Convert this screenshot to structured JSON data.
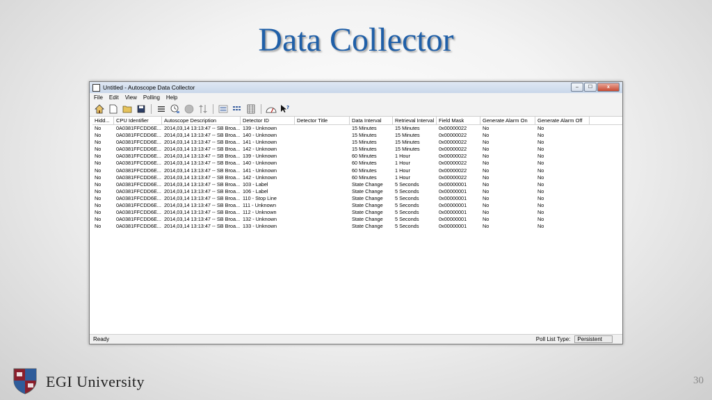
{
  "slide": {
    "title": "Data Collector",
    "page_number": "30",
    "university": "EGI University"
  },
  "window": {
    "title": "Untitled - Autoscope Data Collector",
    "controls": {
      "minimize": "–",
      "maximize": "☐",
      "close": "x"
    }
  },
  "menu": [
    "File",
    "Edit",
    "View",
    "Polling",
    "Help"
  ],
  "toolbar_icons": [
    "home-icon",
    "new-file-icon",
    "open-folder-icon",
    "save-icon",
    "list-icon",
    "clock-icon",
    "record-icon",
    "sort-icon",
    "detail-view-icon",
    "list-view-icon",
    "grid-view-icon",
    "gauge-icon",
    "help-cursor-icon"
  ],
  "table": {
    "columns": [
      "Hidd...",
      "CPU Identifier",
      "Autoscope Description",
      "Detector ID",
      "Detector Title",
      "Data Interval",
      "Retrieval Interval",
      "Field Mask",
      "Generate Alarm On",
      "Generate Alarm Off"
    ],
    "rows": [
      [
        "No",
        "0A0381FFCDD6E...",
        "2014,03,14  13:13:47 -- SB Broa...",
        "139 - Unknown",
        "",
        "15 Minutes",
        "15 Minutes",
        "0x00000022",
        "No",
        "No"
      ],
      [
        "No",
        "0A0381FFCDD6E...",
        "2014,03,14  13:13:47 -- SB Broa...",
        "140 - Unknown",
        "",
        "15 Minutes",
        "15 Minutes",
        "0x00000022",
        "No",
        "No"
      ],
      [
        "No",
        "0A0381FFCDD6E...",
        "2014,03,14  13:13:47 -- SB Broa...",
        "141 - Unknown",
        "",
        "15 Minutes",
        "15 Minutes",
        "0x00000022",
        "No",
        "No"
      ],
      [
        "No",
        "0A0381FFCDD6E...",
        "2014,03,14  13:13:47 -- SB Broa...",
        "142 - Unknown",
        "",
        "15 Minutes",
        "15 Minutes",
        "0x00000022",
        "No",
        "No"
      ],
      [
        "No",
        "0A0381FFCDD6E...",
        "2014,03,14  13:13:47 -- SB Broa...",
        "139 - Unknown",
        "",
        "60 Minutes",
        "1 Hour",
        "0x00000022",
        "No",
        "No"
      ],
      [
        "No",
        "0A0381FFCDD6E...",
        "2014,03,14  13:13:47 -- SB Broa...",
        "140 - Unknown",
        "",
        "60 Minutes",
        "1 Hour",
        "0x00000022",
        "No",
        "No"
      ],
      [
        "No",
        "0A0381FFCDD6E...",
        "2014,03,14  13:13:47 -- SB Broa...",
        "141 - Unknown",
        "",
        "60 Minutes",
        "1 Hour",
        "0x00000022",
        "No",
        "No"
      ],
      [
        "No",
        "0A0381FFCDD6E...",
        "2014,03,14  13:13:47 -- SB Broa...",
        "142 - Unknown",
        "",
        "60 Minutes",
        "1 Hour",
        "0x00000022",
        "No",
        "No"
      ],
      [
        "No",
        "0A0381FFCDD6E...",
        "2014,03,14  13:13:47 -- SB Broa...",
        "103 - Label",
        "",
        "State Change",
        "5 Seconds",
        "0x00000001",
        "No",
        "No"
      ],
      [
        "No",
        "0A0381FFCDD6E...",
        "2014,03,14  13:13:47 -- SB Broa...",
        "106 - Label",
        "",
        "State Change",
        "5 Seconds",
        "0x00000001",
        "No",
        "No"
      ],
      [
        "No",
        "0A0381FFCDD6E...",
        "2014,03,14  13:13:47 -- SB Broa...",
        "110 - Stop Line",
        "",
        "State Change",
        "5 Seconds",
        "0x00000001",
        "No",
        "No"
      ],
      [
        "No",
        "0A0381FFCDD6E...",
        "2014,03,14  13:13:47 -- SB Broa...",
        "111 - Unknown",
        "",
        "State Change",
        "5 Seconds",
        "0x00000001",
        "No",
        "No"
      ],
      [
        "No",
        "0A0381FFCDD6E...",
        "2014,03,14  13:13:47 -- SB Broa...",
        "112 - Unknown",
        "",
        "State Change",
        "5 Seconds",
        "0x00000001",
        "No",
        "No"
      ],
      [
        "No",
        "0A0381FFCDD6E...",
        "2014,03,14  13:13:47 -- SB Broa...",
        "132 - Unknown",
        "",
        "State Change",
        "5 Seconds",
        "0x00000001",
        "No",
        "No"
      ],
      [
        "No",
        "0A0381FFCDD6E...",
        "2014,03,14  13:13:47 -- SB Broa...",
        "133 - Unknown",
        "",
        "State Change",
        "5 Seconds",
        "0x00000001",
        "No",
        "No"
      ]
    ]
  },
  "status": {
    "text": "Ready",
    "poll_list_label": "Poll List Type:",
    "poll_list_value": "Persistent"
  },
  "colors": {
    "title_blue": "#1f5fa8",
    "shield_red": "#8b1e2b",
    "shield_blue": "#2f5c9a"
  }
}
